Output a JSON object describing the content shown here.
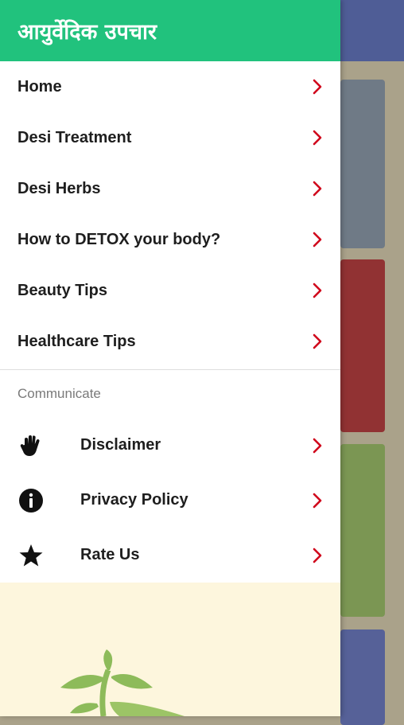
{
  "header": {
    "title": "आयुर्वेदिक उपचार"
  },
  "menu": [
    {
      "label": "Home"
    },
    {
      "label": "Desi Treatment"
    },
    {
      "label": "Desi Herbs"
    },
    {
      "label": "How to DETOX your body?"
    },
    {
      "label": "Beauty Tips"
    },
    {
      "label": "Healthcare Tips"
    }
  ],
  "communicate": {
    "section_label": "Communicate",
    "items": [
      {
        "label": "Disclaimer",
        "icon": "hand-icon"
      },
      {
        "label": "Privacy Policy",
        "icon": "info-icon"
      },
      {
        "label": "Rate Us",
        "icon": "star-icon"
      }
    ]
  },
  "colors": {
    "header_bg": "#21c27d",
    "chevron": "#d0021b",
    "footer_bg": "#fdf6dd",
    "leaf": "#8dbb5a"
  }
}
